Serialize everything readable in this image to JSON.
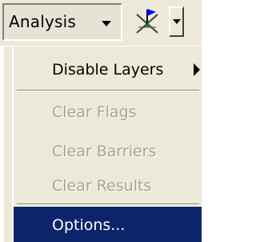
{
  "toolbar": {
    "analysis_label": "Analysis",
    "analysis_arrow_icon": "triangle-down-icon",
    "flag_tool_icon": "network-flag-icon",
    "flag_dropdown_icon": "triangle-down-icon"
  },
  "menu": {
    "items": [
      {
        "label": "Disable Layers",
        "enabled": true,
        "submenu": true
      },
      {
        "label": "Clear Flags",
        "enabled": false
      },
      {
        "label": "Clear Barriers",
        "enabled": false
      },
      {
        "label": "Clear Results",
        "enabled": false
      },
      {
        "label": "Options...",
        "enabled": true,
        "selected": true
      }
    ]
  },
  "colors": {
    "menu_bg": "#ece9d8",
    "highlight": "#0b246a",
    "disabled_text": "#a6a497",
    "flag_blue": "#0000ff"
  }
}
